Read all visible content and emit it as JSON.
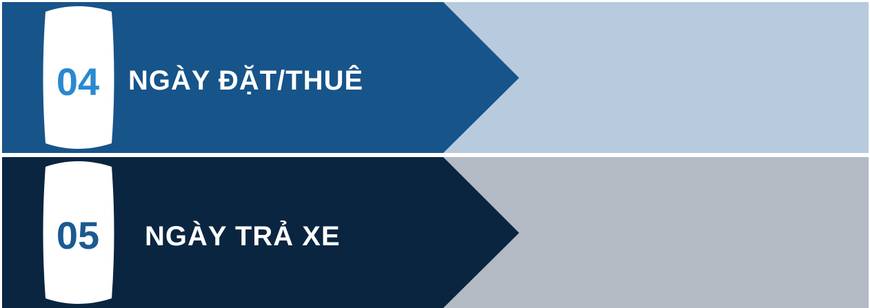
{
  "steps": [
    {
      "number": "04",
      "label": "NGÀY ĐẶT/THUÊ",
      "colors": {
        "arrow": "#17548a",
        "panel": "#b8cbde",
        "number": "#2a89d0",
        "badge": "#ffffff"
      }
    },
    {
      "number": "05",
      "label": "NGÀY TRẢ XE",
      "colors": {
        "arrow": "#0a2540",
        "panel": "#b3bac4",
        "number": "#1a5a92",
        "badge": "#ffffff"
      }
    }
  ]
}
